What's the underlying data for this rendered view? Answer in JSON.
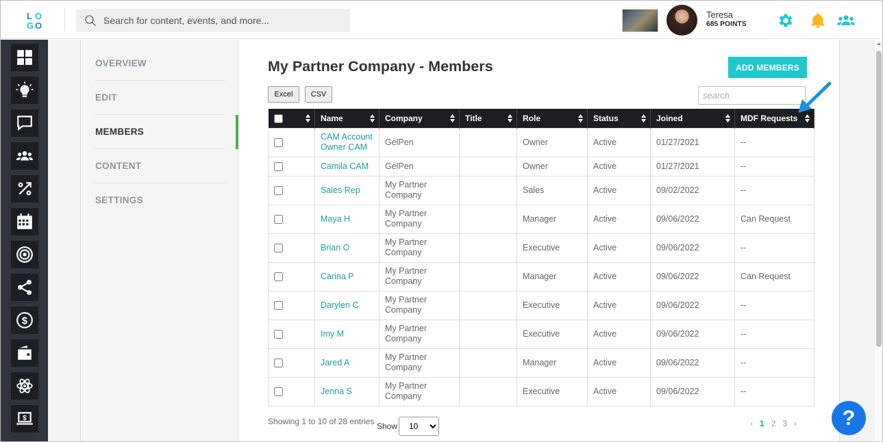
{
  "header": {
    "logo_text": "LOGO",
    "search_placeholder": "Search for content, events, and more...",
    "user_name": "Teresa",
    "user_points": "685 POINTS"
  },
  "icons": {
    "search": "search-icon",
    "settings": "gear-icon",
    "notifications": "bell-icon",
    "team": "users-icon",
    "help": "help-icon"
  },
  "colors": {
    "accent": "#1ec8cc",
    "link": "#1a9ea3",
    "active_indicator": "#4caf50",
    "nav_bg": "#2f353b",
    "help_button": "#1877e8",
    "bell": "#f5b820"
  },
  "leftnav": [
    "dashboard-icon",
    "lightbulb-icon",
    "chat-icon",
    "users-icon",
    "percent-icon",
    "calendar-icon",
    "target-icon",
    "share-icon",
    "dollar-icon",
    "wallet-icon",
    "atom-icon",
    "laptop-dollar-icon"
  ],
  "subnav": {
    "items": [
      {
        "label": "OVERVIEW"
      },
      {
        "label": "EDIT"
      },
      {
        "label": "MEMBERS"
      },
      {
        "label": "CONTENT"
      },
      {
        "label": "SETTINGS"
      }
    ],
    "active": "MEMBERS"
  },
  "main": {
    "title": "My Partner Company - Members",
    "add_button": "ADD MEMBERS",
    "export_excel": "Excel",
    "export_csv": "CSV",
    "table_search_placeholder": "search"
  },
  "table": {
    "columns": [
      "",
      "Name",
      "Company",
      "Title",
      "Role",
      "Status",
      "Joined",
      "MDF Requests"
    ],
    "rows": [
      {
        "name": "CAM Account Owner CAM",
        "company": "GelPen",
        "title": "",
        "role": "Owner",
        "status": "Active",
        "joined": "01/27/2021",
        "mdf": "--"
      },
      {
        "name": "Camila CAM",
        "company": "GelPen",
        "title": "",
        "role": "Owner",
        "status": "Active",
        "joined": "01/27/2021",
        "mdf": "--"
      },
      {
        "name": "Sales Rep",
        "company": "My Partner Company",
        "title": "",
        "role": "Sales",
        "status": "Active",
        "joined": "09/02/2022",
        "mdf": "--"
      },
      {
        "name": "Maya H",
        "company": "My Partner Company",
        "title": "",
        "role": "Manager",
        "status": "Active",
        "joined": "09/06/2022",
        "mdf": "Can Request"
      },
      {
        "name": "Brian O",
        "company": "My Partner Company",
        "title": "",
        "role": "Executive",
        "status": "Active",
        "joined": "09/06/2022",
        "mdf": "--"
      },
      {
        "name": "Carina P",
        "company": "My Partner Company",
        "title": "",
        "role": "Manager",
        "status": "Active",
        "joined": "09/06/2022",
        "mdf": "Can Request"
      },
      {
        "name": "Darylen C",
        "company": "My Partner Company",
        "title": "",
        "role": "Executive",
        "status": "Active",
        "joined": "09/06/2022",
        "mdf": "--"
      },
      {
        "name": "Imy M",
        "company": "My Partner Company",
        "title": "",
        "role": "Executive",
        "status": "Active",
        "joined": "09/06/2022",
        "mdf": "--"
      },
      {
        "name": "Jared A",
        "company": "My Partner Company",
        "title": "",
        "role": "Manager",
        "status": "Active",
        "joined": "09/06/2022",
        "mdf": "--"
      },
      {
        "name": "Jenna S",
        "company": "My Partner Company",
        "title": "",
        "role": "Executive",
        "status": "Active",
        "joined": "09/06/2022",
        "mdf": "--"
      }
    ]
  },
  "footer": {
    "showing": "Showing 1 to 10 of 28 entries",
    "show_label": "Show",
    "page_size": "10",
    "prev": "‹",
    "pages": [
      "1",
      "2",
      "3"
    ],
    "current_page": "1",
    "next": "›"
  },
  "help": {
    "label": "?"
  }
}
